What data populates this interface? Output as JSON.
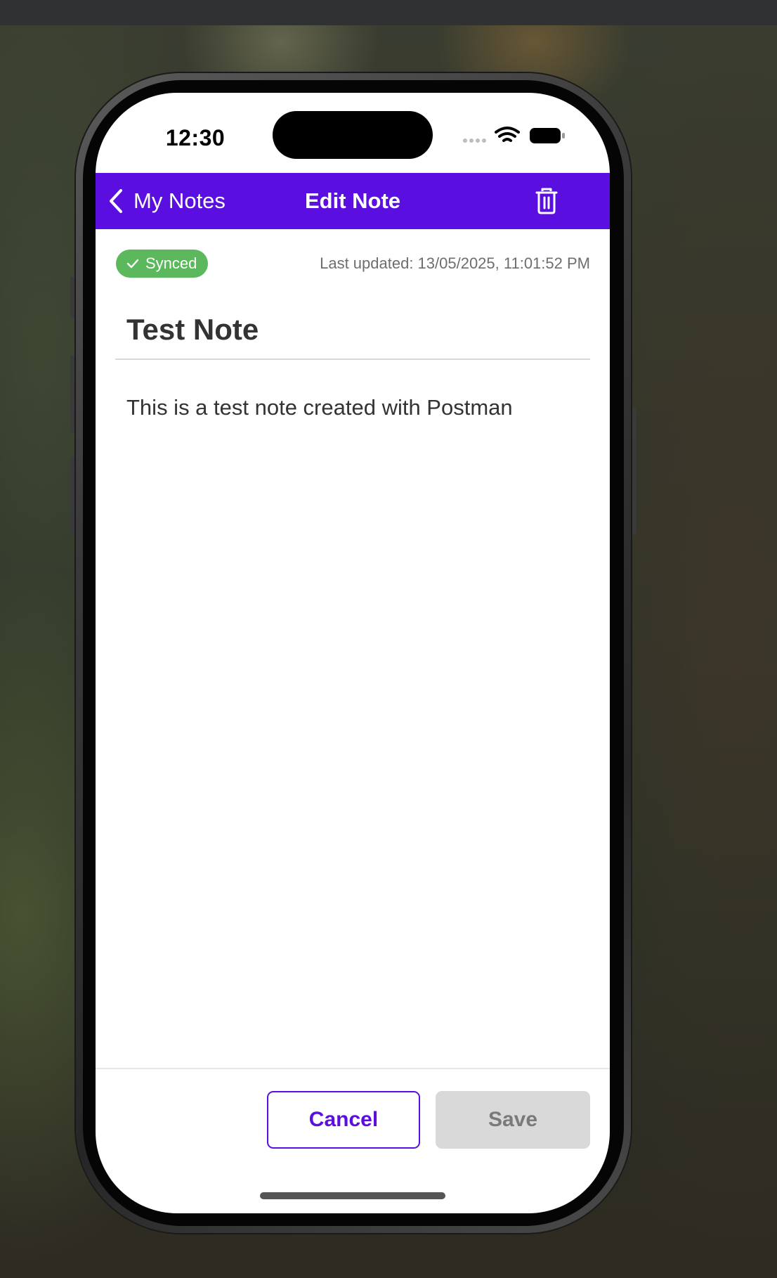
{
  "status_bar": {
    "time": "12:30",
    "icons": [
      "cellular-signal-icon",
      "wifi-icon",
      "battery-icon"
    ]
  },
  "nav": {
    "back_label": "My Notes",
    "title": "Edit Note",
    "delete_icon": "trash-icon"
  },
  "note": {
    "sync_status": "Synced",
    "last_updated": "Last updated: 13/05/2025, 11:01:52 PM",
    "title": "Test Note",
    "body": "This is a test note created with Postman"
  },
  "actions": {
    "cancel_label": "Cancel",
    "save_label": "Save"
  },
  "colors": {
    "accent": "#5a0fe0",
    "synced_badge": "#5cb85c",
    "disabled_button": "#d9d9d9"
  }
}
